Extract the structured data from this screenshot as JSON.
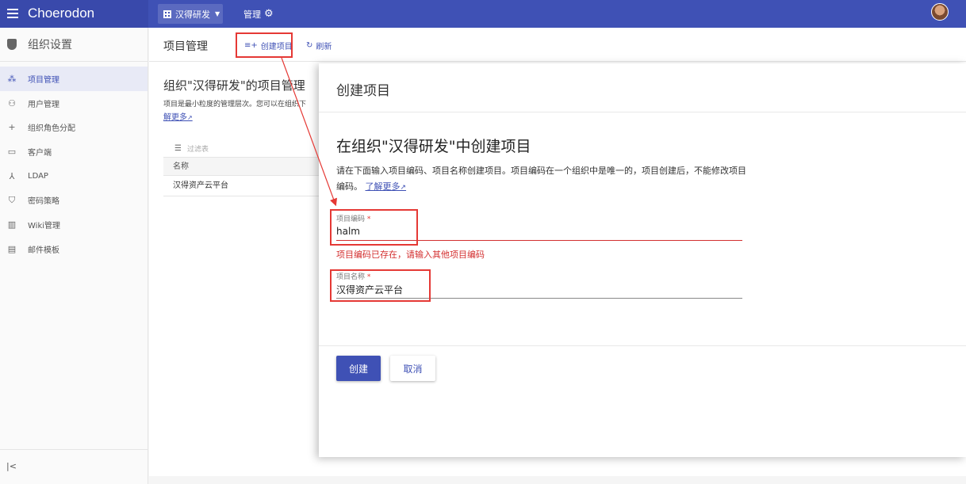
{
  "topbar": {
    "app_name": "Choerodon",
    "org_name": "汉得研发",
    "manage_label": "管理"
  },
  "sidebar": {
    "header": "组织设置",
    "items": [
      {
        "label": "项目管理",
        "icon": "project-icon",
        "active": true
      },
      {
        "label": "用户管理",
        "icon": "user-icon",
        "active": false
      },
      {
        "label": "组织角色分配",
        "icon": "person-add-icon",
        "active": false
      },
      {
        "label": "客户端",
        "icon": "laptop-icon",
        "active": false
      },
      {
        "label": "LDAP",
        "icon": "ldap-icon",
        "active": false
      },
      {
        "label": "密码策略",
        "icon": "shield-icon",
        "active": false
      },
      {
        "label": "Wiki管理",
        "icon": "book-icon",
        "active": false
      },
      {
        "label": "邮件模板",
        "icon": "template-icon",
        "active": false
      }
    ],
    "collapse_icon": "collapse-icon"
  },
  "page": {
    "title": "项目管理",
    "create_btn": "创建项目",
    "refresh_btn": "刷新",
    "content_title": "组织\"汉得研发\"的项目管理",
    "content_desc": "项目是最小粒度的管理层次。您可以在组织下",
    "content_more": "解更多",
    "filter_placeholder": "过滤表",
    "table_header": "名称",
    "table_rows": [
      "汉得资产云平台"
    ]
  },
  "modal": {
    "title": "创建项目",
    "heading": "在组织\"汉得研发\"中创建项目",
    "desc": "请在下面输入项目编码、项目名称创建项目。项目编码在一个组织中是唯一的，项目创建后，不能修改项目编码。",
    "learn_more": "了解更多",
    "code_label": "项目编码",
    "code_value": "halm",
    "code_error": "项目编码已存在，请输入其他项目编码",
    "name_label": "项目名称",
    "name_value": "汉得资产云平台",
    "required_mark": "*",
    "create_btn": "创建",
    "cancel_btn": "取消"
  },
  "colors": {
    "primary": "#3f51b5",
    "error": "#d32f2f",
    "annotation": "#e53935"
  }
}
